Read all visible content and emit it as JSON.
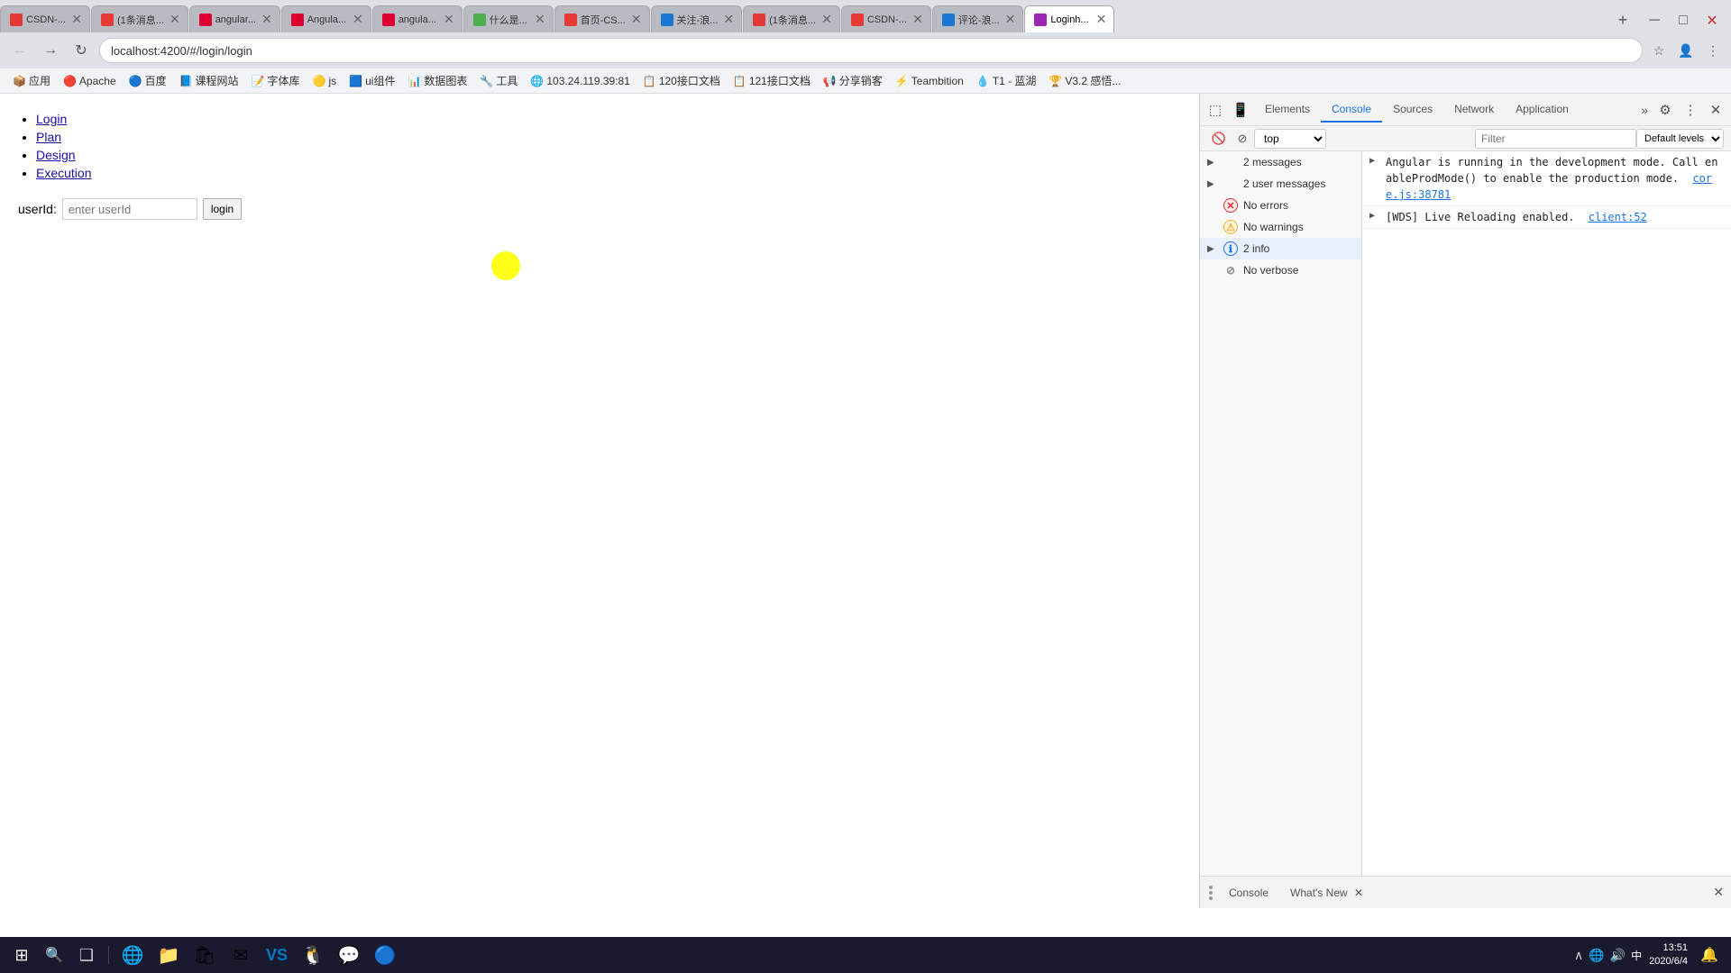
{
  "browser": {
    "url": "localhost:4200/#/login/login",
    "tabs": [
      {
        "id": "t1",
        "label": "CSDN-...",
        "favicon_color": "#e53935",
        "active": false
      },
      {
        "id": "t2",
        "label": "(1条消息...",
        "favicon_color": "#e53935",
        "active": false
      },
      {
        "id": "t3",
        "label": "angular...",
        "favicon_color": "#dd0031",
        "active": false
      },
      {
        "id": "t4",
        "label": "Angula...",
        "favicon_color": "#dd0031",
        "active": false
      },
      {
        "id": "t5",
        "label": "angula...",
        "favicon_color": "#dd0031",
        "active": false
      },
      {
        "id": "t6",
        "label": "什么是...",
        "favicon_color": "#4caf50",
        "active": false
      },
      {
        "id": "t7",
        "label": "首页-CS...",
        "favicon_color": "#e53935",
        "active": false
      },
      {
        "id": "t8",
        "label": "关注-浪...",
        "favicon_color": "#1976d2",
        "active": false
      },
      {
        "id": "t9",
        "label": "(1条消息...",
        "favicon_color": "#e53935",
        "active": false
      },
      {
        "id": "t10",
        "label": "CSDN-...",
        "favicon_color": "#e53935",
        "active": false
      },
      {
        "id": "t11",
        "label": "评论-浪...",
        "favicon_color": "#1976d2",
        "active": false
      },
      {
        "id": "t12",
        "label": "Loginh...",
        "favicon_color": "#9c27b0",
        "active": true
      }
    ],
    "bookmarks": [
      {
        "label": "应用",
        "icon": "📦"
      },
      {
        "label": "Apache",
        "icon": "🔴"
      },
      {
        "label": "百度",
        "icon": "🔵"
      },
      {
        "label": "课程网站",
        "icon": "📘"
      },
      {
        "label": "字体库",
        "icon": "📝"
      },
      {
        "label": "js",
        "icon": "🟡"
      },
      {
        "label": "ui组件",
        "icon": "🟦"
      },
      {
        "label": "数据图表",
        "icon": "📊"
      },
      {
        "label": "工具",
        "icon": "🔧"
      },
      {
        "label": "103.24.119.39:81",
        "icon": "🌐"
      },
      {
        "label": "120接口文档",
        "icon": "📋"
      },
      {
        "label": "121接口文档",
        "icon": "📋"
      },
      {
        "label": "分享销客",
        "icon": "📢"
      },
      {
        "label": "Teambition",
        "icon": "⚡"
      },
      {
        "label": "T1 - 蓝湖",
        "icon": "💧"
      },
      {
        "label": "V3.2 感悟...",
        "icon": "🏆"
      }
    ]
  },
  "page": {
    "nav_links": [
      "Login",
      "Plan",
      "Design",
      "Execution"
    ],
    "userid_label": "userId:",
    "input_placeholder": "enter userId",
    "login_btn": "login"
  },
  "devtools": {
    "tabs": [
      "Elements",
      "Console",
      "Sources",
      "Network",
      "Application"
    ],
    "active_tab": "Console",
    "top_selector": "top",
    "filter_placeholder": "Filter",
    "filter_level": "Default levels",
    "sidebar_items": [
      {
        "label": "2 messages",
        "expand": true,
        "icon_type": "none"
      },
      {
        "label": "2 user messages",
        "expand": true,
        "icon_type": "none"
      },
      {
        "label": "No errors",
        "icon_type": "error"
      },
      {
        "label": "No warnings",
        "icon_type": "warning"
      },
      {
        "label": "2 info",
        "icon_type": "info",
        "active": true,
        "expand": true
      },
      {
        "label": "No verbose",
        "icon_type": "verbose"
      }
    ],
    "log_entries": [
      {
        "type": "info",
        "text": "Angular is running in the development mode.  Call enableProdMode() to enable the production mode.",
        "link": "core.js:38781"
      },
      {
        "type": "info",
        "text": "[WDS] Live Reloading enabled.",
        "link": "client:52"
      }
    ]
  },
  "bottom_bar": {
    "console_label": "Console",
    "whats_new_label": "What's New"
  },
  "taskbar": {
    "time": "13:51",
    "date": "2020/6/4"
  }
}
